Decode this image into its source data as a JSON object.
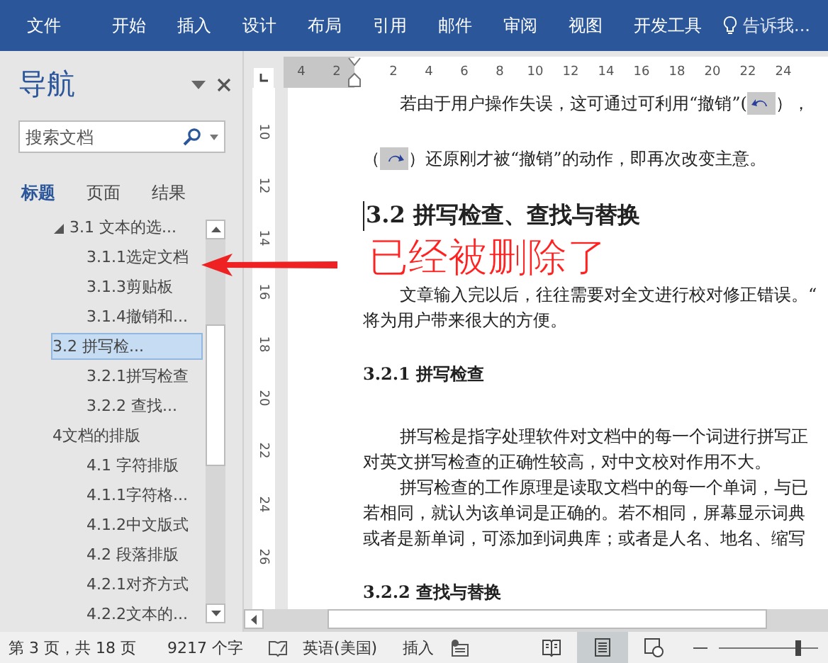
{
  "ribbon_tabs": [
    {
      "label": "文件",
      "selected": false
    },
    {
      "label": "开始",
      "selected": false
    },
    {
      "label": "插入",
      "selected": false
    },
    {
      "label": "设计",
      "selected": false
    },
    {
      "label": "布局",
      "selected": false
    },
    {
      "label": "引用",
      "selected": false
    },
    {
      "label": "邮件",
      "selected": false
    },
    {
      "label": "审阅",
      "selected": false
    },
    {
      "label": "视图",
      "selected": false
    },
    {
      "label": "开发工具",
      "selected": false
    }
  ],
  "tell_me": "告诉我...",
  "navigation": {
    "title": "导航",
    "search": {
      "placeholder": "搜索文档"
    },
    "tabs": [
      {
        "label": "标题",
        "selected": true
      },
      {
        "label": "页面",
        "selected": false
      },
      {
        "label": "结果",
        "selected": false
      }
    ],
    "items": [
      {
        "label": "3.1 文本的选...",
        "selected": false,
        "expanded": true,
        "children": [
          {
            "label": "3.1.1选定文档",
            "selected": false
          },
          {
            "label": "3.1.3剪贴板",
            "selected": false
          },
          {
            "label": "3.1.4撤销和...",
            "selected": false
          }
        ]
      },
      {
        "label": "3.2 拼写检...",
        "selected": true,
        "children": [
          {
            "label": "3.2.1拼写检查",
            "selected": false
          },
          {
            "label": "3.2.2 查找...",
            "selected": false
          }
        ]
      },
      {
        "label": "4文档的排版",
        "selected": false,
        "children": [
          {
            "label": "4.1 字符排版",
            "selected": false
          },
          {
            "label": "4.1.1字符格...",
            "selected": false
          },
          {
            "label": "4.1.2中文版式",
            "selected": false
          },
          {
            "label": "4.2 段落排版",
            "selected": false
          },
          {
            "label": "4.2.1对齐方式",
            "selected": false
          },
          {
            "label": "4.2.2文本的...",
            "selected": false
          }
        ]
      }
    ]
  },
  "ruler": {
    "horizontal": [
      "4",
      "2",
      "2",
      "4",
      "6",
      "8",
      "10",
      "12",
      "14",
      "16",
      "18",
      "20",
      "22",
      "24"
    ],
    "vertical": [
      "10",
      "12",
      "14",
      "16",
      "18",
      "20",
      "22",
      "24",
      "26"
    ]
  },
  "document": [
    {
      "kind": "para",
      "lines": [
        {
          "indent": true,
          "parts": [
            {
              "kind": "text",
              "text": "若由于用户操作失误，这可通过可利用“撤销”("
            },
            {
              "kind": "undo"
            },
            {
              "kind": "text",
              "text": "），"
            }
          ]
        }
      ]
    },
    {
      "kind": "para",
      "lines": [
        {
          "indent": false,
          "parts": [
            {
              "kind": "text",
              "text": "（"
            },
            {
              "kind": "redo"
            },
            {
              "kind": "text",
              "text": "）还原刚才被“撤销”的动作，即再次改变主意。"
            }
          ]
        }
      ]
    },
    {
      "kind": "heading",
      "text": "3.2  拼写检查、查找与替换"
    },
    {
      "kind": "para",
      "lines": [
        {
          "indent": true,
          "parts": [
            {
              "kind": "text",
              "text": "文章输入完以后，往往需要对全文进行校对修正错误。“"
            }
          ]
        },
        {
          "indent": false,
          "parts": [
            {
              "kind": "text",
              "text": "将为用户带来很大的方便。"
            }
          ]
        }
      ]
    },
    {
      "kind": "subheading",
      "text": "3.2.1 拼写检查"
    },
    {
      "kind": "para",
      "lines": [
        {
          "indent": true,
          "parts": [
            {
              "kind": "text",
              "text": "拼写检是指字处理软件对文档中的每一个词进行拼写正"
            }
          ]
        },
        {
          "indent": false,
          "parts": [
            {
              "kind": "text",
              "text": "对英文拼写检查的正确性较高，对中文校对作用不大。"
            }
          ]
        },
        {
          "indent": true,
          "parts": [
            {
              "kind": "text",
              "text": "拼写检查的工作原理是读取文档中的每一个单词，与已"
            }
          ]
        },
        {
          "indent": false,
          "parts": [
            {
              "kind": "text",
              "text": "若相同，就认为该单词是正确的。若不相同，屏幕显示词典"
            }
          ]
        },
        {
          "indent": false,
          "parts": [
            {
              "kind": "text",
              "text": "或者是新单词，可添加到词典库；或者是人名、地名、缩写"
            }
          ]
        }
      ]
    },
    {
      "kind": "subheading",
      "text": "3.2.2 查找与替换"
    }
  ],
  "annotation": "已经被删除了",
  "status_bar": {
    "page": "第 3 页，共 18 页",
    "words": "9217 个字",
    "language": "英语(美国)",
    "mode": "插入",
    "views": [
      {
        "kind": "read",
        "selected": false
      },
      {
        "kind": "print",
        "selected": true
      },
      {
        "kind": "web",
        "selected": false
      }
    ],
    "zoom": {
      "level": 0.8
    }
  }
}
